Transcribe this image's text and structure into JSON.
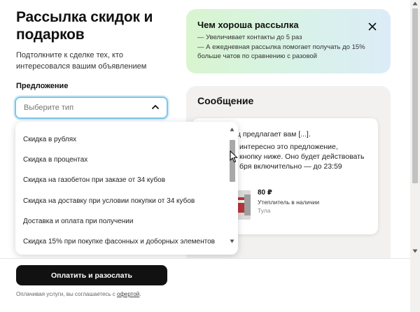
{
  "header": {
    "title": "Рассылка скидок и подарков",
    "subtitle": "Подтолкните к сделке тех, кто интересовался вашим объявлением"
  },
  "offer": {
    "label": "Предложение",
    "placeholder": "Выберите тип",
    "options": [
      "Скидка в рублях",
      "Скидка в процентах",
      "Скидка на газобетон при заказе от 34 кубов",
      "Скидка на доставку при условии покупки от 34 кубов",
      "Доставка и оплата при получении",
      "Скидка 15% при покупке фасонных и доборных элементов"
    ]
  },
  "benefits": {
    "title": "Чем хороша рассылка",
    "items": [
      "—  Увеличивает контакты до 5 раз",
      "—  А ежедневная рассылка помогает получать до 15%",
      "больше чатов по сравнению с разовой"
    ]
  },
  "message": {
    "title": "Сообщение",
    "lines": [
      "ц предлагает вам [...].",
      "интересно это предложение,",
      "кнопку ниже. Оно будет действовать",
      "бря включительно — до 23:59"
    ],
    "product": {
      "price": "80 ₽",
      "name": "Утеплитель в наличии",
      "city": "Тула"
    }
  },
  "footer": {
    "pay_label": "Оплатить и разослать",
    "legal_text": "Оплачивая услуги, вы соглашаетесь с ",
    "legal_link": "офертой",
    "legal_end": "."
  },
  "colors": {
    "accent_focus": "#7cc7ea",
    "button_bg": "#111111",
    "panel_bg": "#f2f1ef"
  },
  "icons": {
    "select_chevron": "chevron-up-icon",
    "benefits_close": "close-icon",
    "cursor": "mouse-pointer-icon"
  }
}
